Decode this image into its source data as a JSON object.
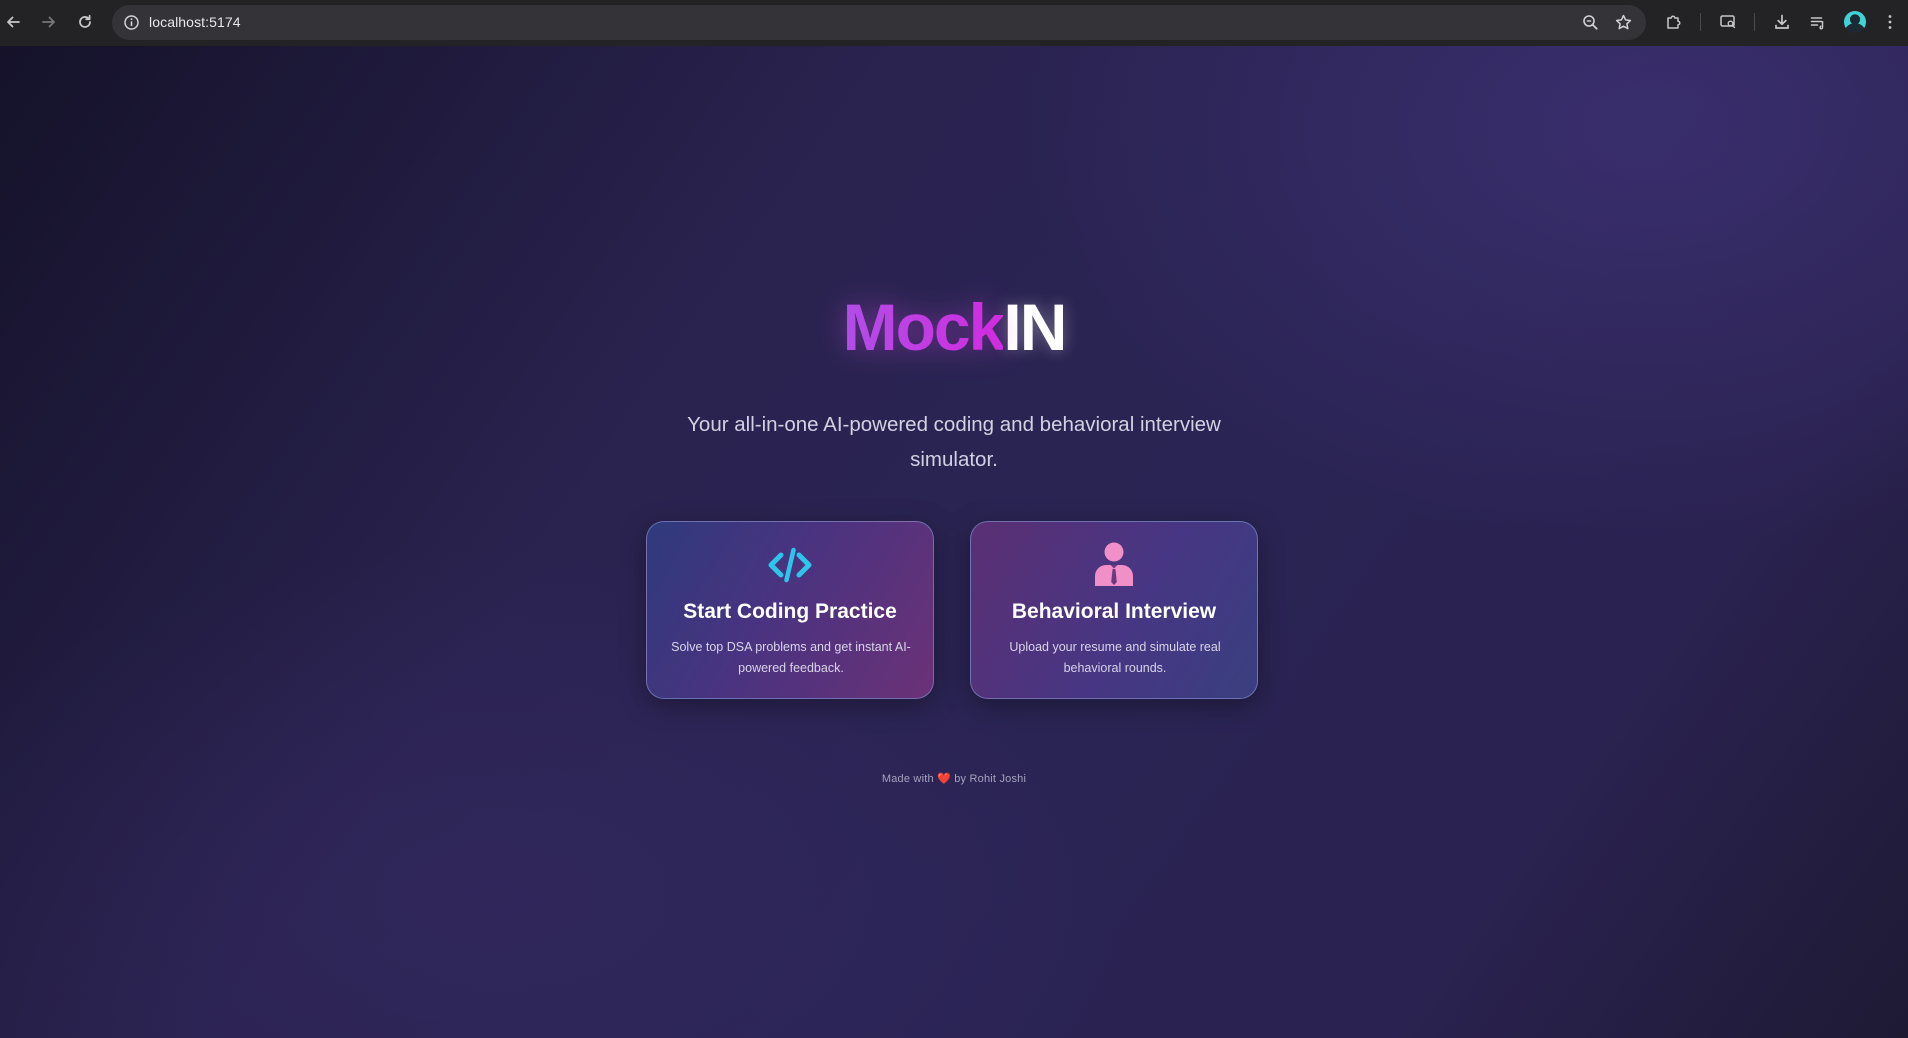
{
  "browser": {
    "url": "localhost:5174",
    "icons": {
      "back": "arrow-left-icon",
      "forward": "arrow-right-icon",
      "reload": "reload-icon",
      "site_info": "info-icon",
      "zoom": "zoom-icon",
      "bookmark": "star-icon",
      "extensions": "puzzle-icon",
      "tab_search": "tab-search-icon",
      "downloads": "download-icon",
      "reading_list": "reading-list-icon",
      "profile": "avatar",
      "menu": "kebab-menu-icon"
    }
  },
  "hero": {
    "brand_part1": "Mock",
    "brand_part2": "IN",
    "tagline": "Your all-in-one AI-powered coding and behavioral interview simulator."
  },
  "cards": [
    {
      "title": "Start Coding Practice",
      "description": "Solve top DSA problems and get instant AI-powered feedback.",
      "icon": "code-icon"
    },
    {
      "title": "Behavioral Interview",
      "description": "Upload your resume and simulate real behavioral rounds.",
      "icon": "person-tie-icon"
    }
  ],
  "footer": {
    "prefix": "Made with",
    "heart": "❤️",
    "suffix": "by Rohit Joshi"
  },
  "colors": {
    "brand_gradient_start": "#b14ee6",
    "brand_gradient_end": "#d12be0",
    "code_icon": "#2ec5ea",
    "person_icon": "#f08fc8",
    "background": "#2a2350"
  }
}
